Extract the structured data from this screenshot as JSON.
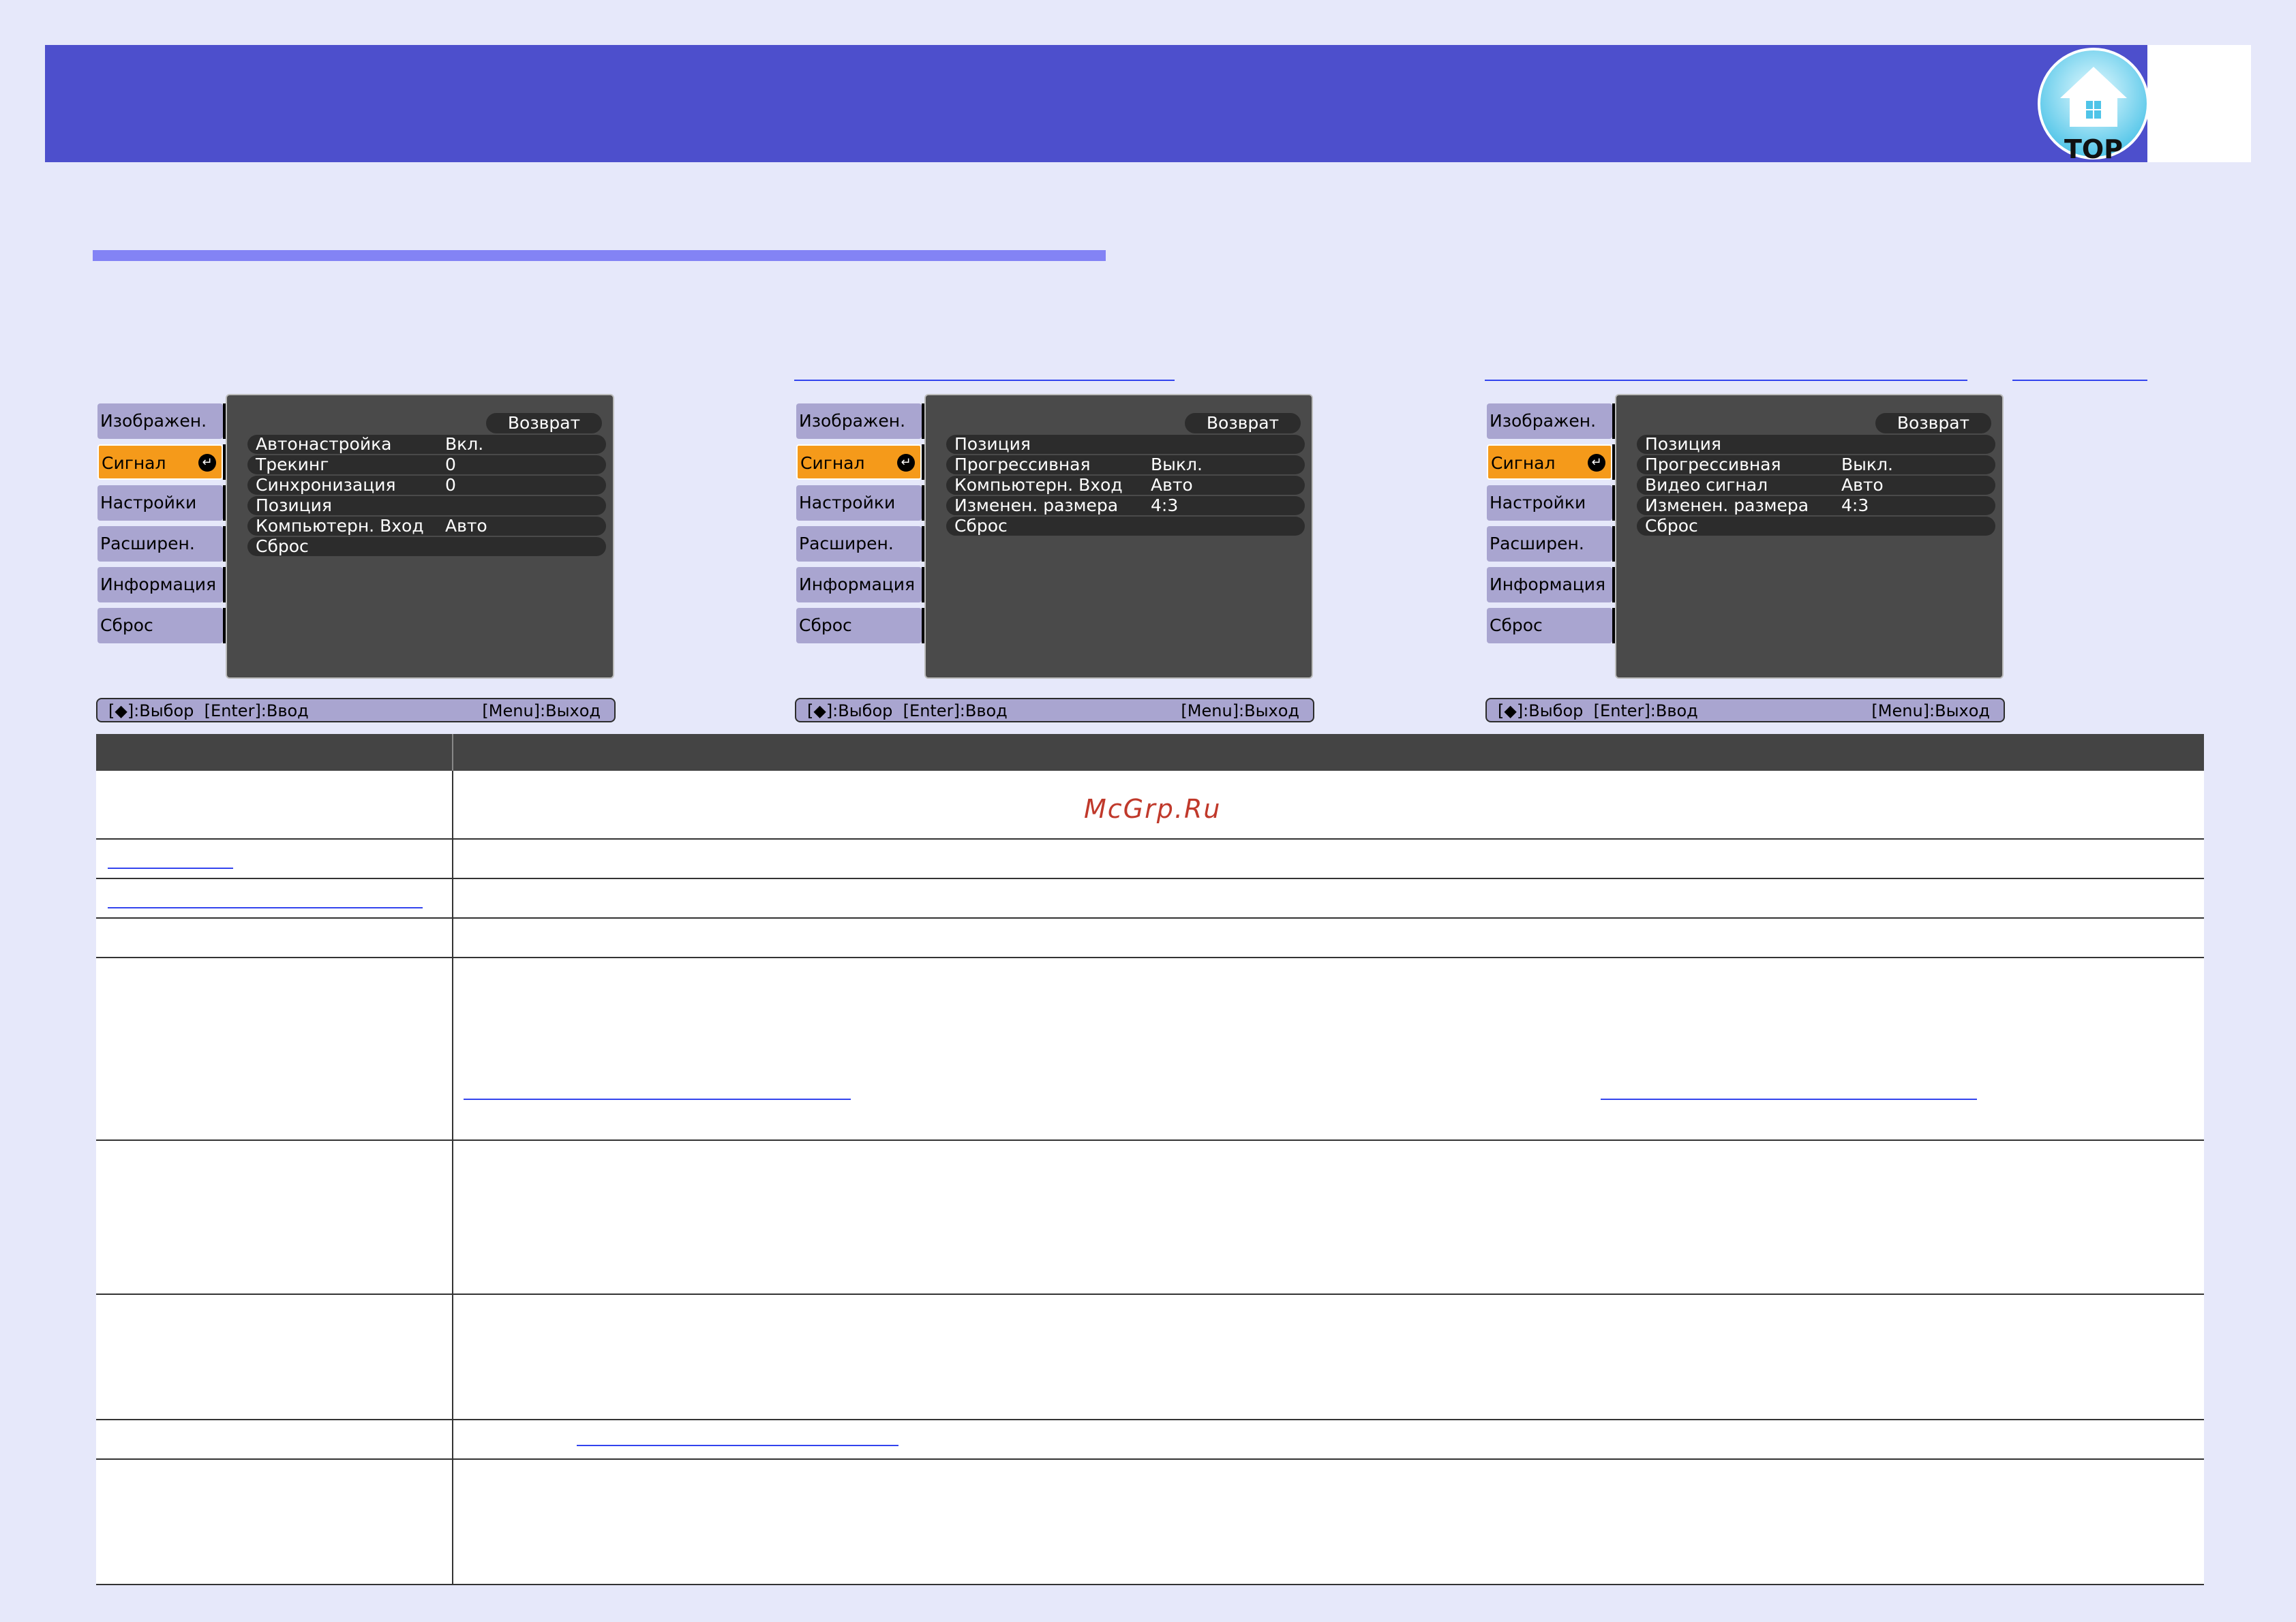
{
  "header": {
    "logo_text": "TOP",
    "colors": {
      "bar": "#4d4fcc",
      "accent_line": "#8383f5",
      "link": "#3344ee"
    }
  },
  "menus": [
    {
      "sidebar": [
        "Изображен.",
        "Сигнал",
        "Настройки",
        "Расширен.",
        "Информация",
        "Сброс"
      ],
      "active_index": 1,
      "return_label": "Возврат",
      "rows": [
        {
          "label": "Автонастройка",
          "value": "Вкл."
        },
        {
          "label": "Трекинг",
          "value": "0"
        },
        {
          "label": "Синхронизация",
          "value": "0"
        },
        {
          "label": "Позиция",
          "value": ""
        },
        {
          "label": "Компьютерн. Вход",
          "value": "Авто"
        },
        {
          "label": "Сброс",
          "value": ""
        }
      ],
      "footer_left": "[◆]:Выбор  [Enter]:Ввод",
      "footer_right": "[Menu]:Выход"
    },
    {
      "sidebar": [
        "Изображен.",
        "Сигнал",
        "Настройки",
        "Расширен.",
        "Информация",
        "Сброс"
      ],
      "active_index": 1,
      "return_label": "Возврат",
      "rows": [
        {
          "label": "Позиция",
          "value": ""
        },
        {
          "label": "Прогрессивная",
          "value": "Выкл."
        },
        {
          "label": "Компьютерн. Вход",
          "value": "Авто"
        },
        {
          "label": "Изменен. размера",
          "value": "4:3"
        },
        {
          "label": "Сброс",
          "value": ""
        }
      ],
      "footer_left": "[◆]:Выбор  [Enter]:Ввод",
      "footer_right": "[Menu]:Выход"
    },
    {
      "sidebar": [
        "Изображен.",
        "Сигнал",
        "Настройки",
        "Расширен.",
        "Информация",
        "Сброс"
      ],
      "active_index": 1,
      "return_label": "Возврат",
      "rows": [
        {
          "label": "Позиция",
          "value": ""
        },
        {
          "label": "Прогрессивная",
          "value": "Выкл."
        },
        {
          "label": "Видео сигнал",
          "value": "Авто"
        },
        {
          "label": "Изменен. размера",
          "value": "4:3"
        },
        {
          "label": "Сброс",
          "value": ""
        }
      ],
      "footer_left": "[◆]:Выбор  [Enter]:Ввод",
      "footer_right": "[Menu]:Выход"
    }
  ],
  "watermark": "McGrp.Ru"
}
